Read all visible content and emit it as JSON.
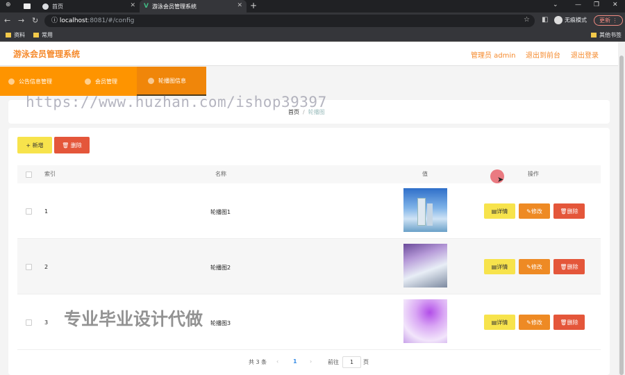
{
  "browser": {
    "tabs": [
      {
        "label": ""
      },
      {
        "label": "首页"
      },
      {
        "label": "游泳会员管理系统"
      }
    ],
    "url_host": "localhost",
    "url_path": ":8081/#/config",
    "incognito_label": "无痕模式",
    "update_label": "更新",
    "bookmarks": [
      "资料",
      "常用"
    ],
    "other_bookmarks": "其他书签"
  },
  "app": {
    "title": "游泳会员管理系统",
    "admin_label": "管理员 admin",
    "back_label": "退出到前台",
    "logout_label": "退出登录",
    "accent_color": "#f5892b"
  },
  "nav": {
    "items": [
      {
        "label": "公告信息管理"
      },
      {
        "label": "会员管理"
      },
      {
        "label": "轮播图信息"
      }
    ]
  },
  "breadcrumb": {
    "home": "首页",
    "separator": "/",
    "current": "轮播图"
  },
  "watermark": "https://www.huzhan.com/ishop39397",
  "toolbar": {
    "add_label": "+ 新增",
    "delete_label": "🗑 删除"
  },
  "table": {
    "headers": {
      "index": "索引",
      "name": "名称",
      "value": "值",
      "actions": "操作"
    },
    "rows": [
      {
        "index": "1",
        "name": "轮播图1"
      },
      {
        "index": "2",
        "name": "轮播图2"
      },
      {
        "index": "3",
        "name": "轮播图3"
      }
    ],
    "row_actions": {
      "detail": "详情",
      "edit": "修改",
      "delete": "删除"
    }
  },
  "promo_text": "专业毕业设计代做",
  "pagination": {
    "total": "共 3 条",
    "current_page": "1",
    "goto_label": "前往",
    "goto_value": "1",
    "page_suffix": "页"
  }
}
